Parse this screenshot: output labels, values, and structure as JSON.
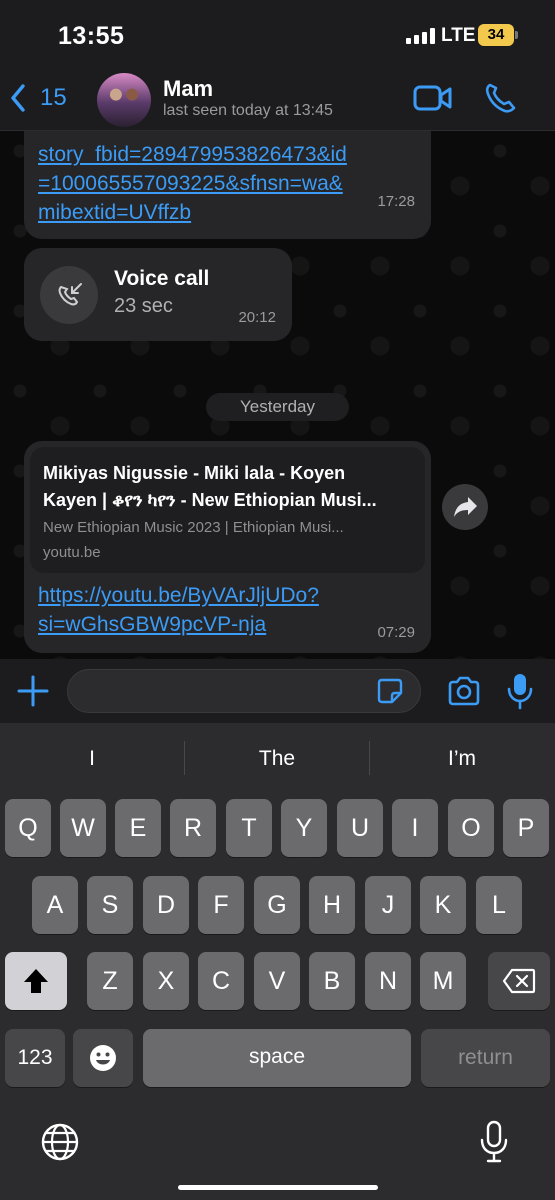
{
  "status_bar": {
    "time": "13:55",
    "network": "LTE",
    "battery": "34"
  },
  "header": {
    "back_count": "15",
    "contact_name": "Mam",
    "last_seen": "last seen today at 13:45",
    "icons": [
      "back-chevron-icon",
      "avatar",
      "video-call-icon",
      "phone-icon"
    ]
  },
  "messages": {
    "link_message": {
      "lines": [
        "story_fbid=289479953826473&id",
        "=100065557093225&sfnsn=wa&",
        "mibextid=UVffzb"
      ],
      "time": "17:28"
    },
    "call_message": {
      "title": "Voice call",
      "duration": "23 sec",
      "time": "20:12",
      "icon": "missed-call-icon"
    },
    "date_divider": "Yesterday",
    "youtube_message": {
      "preview_title": "Mikiyas Nigussie - Miki lala - Koyen Kayen | ቆየን ካየን - New Ethiopian Musi...",
      "preview_title_line1": "Mikiyas Nigussie - Miki lala - Koyen",
      "preview_title_line2": "Kayen | ቆየን ካየን - New Ethiopian Musi...",
      "preview_desc": "New Ethiopian Music 2023 | Ethiopian Musi...",
      "preview_domain": "youtu.be",
      "url_line1": "https://youtu.be/ByVArJljUDo?",
      "url_line2": "si=wGhsGBW9pcVP-nja",
      "time": "07:29"
    }
  },
  "input_bar": {
    "placeholder": "",
    "icons": [
      "plus-icon",
      "sticker-icon",
      "camera-icon",
      "mic-icon"
    ]
  },
  "keyboard": {
    "predictions": [
      "I",
      "The",
      "I’m"
    ],
    "row1": [
      "Q",
      "W",
      "E",
      "R",
      "T",
      "Y",
      "U",
      "I",
      "O",
      "P"
    ],
    "row2": [
      "A",
      "S",
      "D",
      "F",
      "G",
      "H",
      "J",
      "K",
      "L"
    ],
    "row3": [
      "Z",
      "X",
      "C",
      "V",
      "B",
      "N",
      "M"
    ],
    "numbers_key": "123",
    "space_key": "space",
    "return_key": "return",
    "icons": [
      "shift-icon",
      "backspace-icon",
      "emoji-icon",
      "globe-icon",
      "dictation-mic-icon"
    ]
  }
}
